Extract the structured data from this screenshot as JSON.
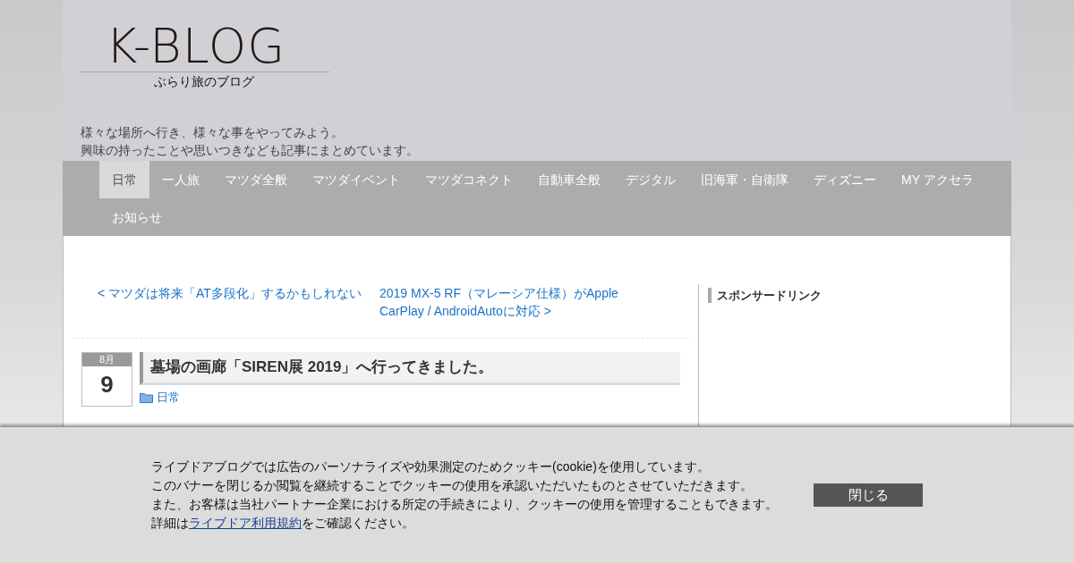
{
  "header": {
    "logo_title": "K-BLOG",
    "logo_subtitle": "ぶらり旅のブログ",
    "tagline": [
      "様々な場所へ行き、様々な事をやってみよう。",
      "興味の持ったことや思いつきなども記事にまとめています。"
    ]
  },
  "nav": [
    {
      "label": "日常",
      "selected": true
    },
    {
      "label": "一人旅",
      "selected": false
    },
    {
      "label": "マツダ全般",
      "selected": false
    },
    {
      "label": "マツダイベント",
      "selected": false
    },
    {
      "label": "マツダコネクト",
      "selected": false
    },
    {
      "label": "自動車全般",
      "selected": false
    },
    {
      "label": "デジタル",
      "selected": false
    },
    {
      "label": "旧海軍・自衛隊",
      "selected": false
    },
    {
      "label": "ディズニー",
      "selected": false
    },
    {
      "label": "MY アクセラ",
      "selected": false
    },
    {
      "label": "お知らせ",
      "selected": false
    }
  ],
  "post_nav": {
    "previous": "< マツダは将来「AT多段化」するかもしれない",
    "next": "2019 MX-5 RF（マレーシア仕様）がApple CarPlay / AndroidAutoに対応 >"
  },
  "post": {
    "month": "8月",
    "day": "9",
    "title": "墓場の画廊「SIREN展 2019」へ行ってきました。",
    "category": "日常"
  },
  "sidebar": {
    "heading": "スポンサードリンク"
  },
  "cookie_banner": {
    "lines": [
      "ライブドアブログでは広告のパーソナライズや効果測定のためクッキー(cookie)を使用しています。",
      "このバナーを閉じるか閲覧を継続することでクッキーの使用を承認いただいたものとさせていただきます。",
      "また、お客様は当社パートナー企業における所定の手続きにより、クッキーの使用を管理することもできます。"
    ],
    "last_line_before": "詳細は",
    "link": "ライブドア利用規約",
    "last_line_after": "をご確認ください。",
    "close_button": "閉じる"
  }
}
